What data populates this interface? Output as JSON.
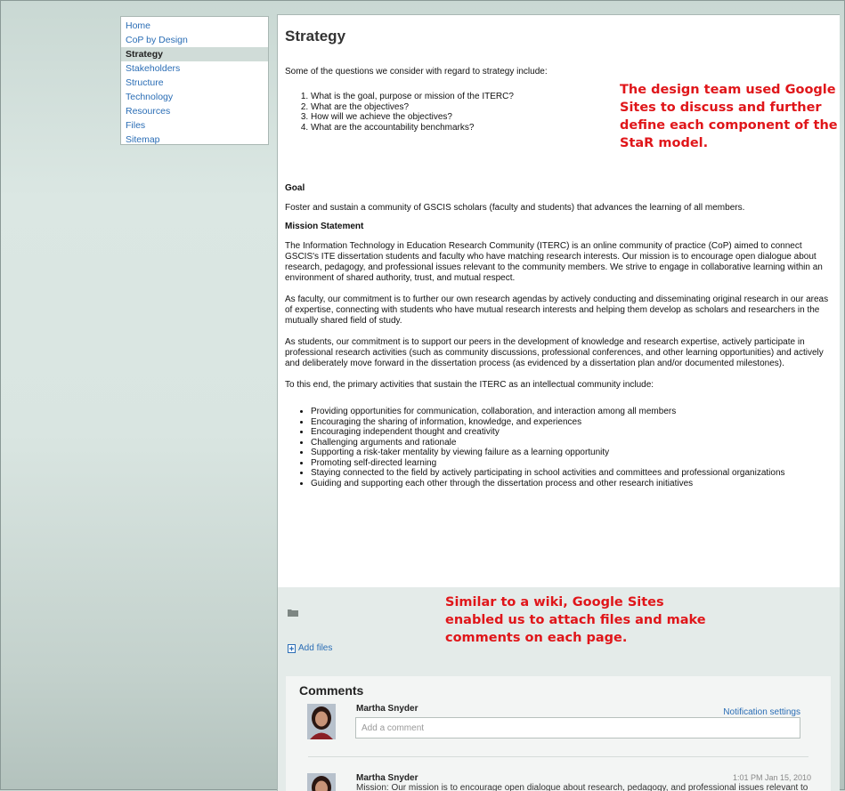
{
  "sidebar": {
    "items": [
      {
        "label": "Home",
        "active": false
      },
      {
        "label": "CoP by Design",
        "active": false
      },
      {
        "label": "Strategy",
        "active": true
      },
      {
        "label": "Stakeholders",
        "active": false
      },
      {
        "label": "Structure",
        "active": false
      },
      {
        "label": "Technology",
        "active": false
      },
      {
        "label": "Resources",
        "active": false
      },
      {
        "label": "Files",
        "active": false
      },
      {
        "label": "Sitemap",
        "active": false
      }
    ]
  },
  "page": {
    "title": "Strategy",
    "intro": "Some of the questions we consider with regard to strategy include:",
    "questions": [
      "What is the goal, purpose or mission of the ITERC?",
      "What are the objectives?",
      "How will we achieve the objectives?",
      "What are the accountability benchmarks?"
    ],
    "goal_heading": "Goal",
    "goal_text": "Foster and sustain a community of GSCIS scholars (faculty and students) that advances the learning of all members.",
    "mission_heading": "Mission Statement",
    "mission_text": "The Information Technology in Education Research Community (ITERC) is an online community of practice (CoP) aimed to connect GSCIS's ITE dissertation students and faculty who have matching research interests. Our mission is to encourage open dialogue about research, pedagogy, and professional issues relevant to the community members. We strive to engage in collaborative learning within an environment of shared authority, trust, and mutual respect.",
    "faculty_text": "As faculty, our commitment is to further our own research agendas by actively conducting and disseminating original research in our areas of expertise, connecting with students who have mutual research interests and helping them develop as scholars and researchers in the mutually shared field of study.",
    "students_text": "As students, our commitment is to support our peers in the development of knowledge and research expertise, actively participate in professional research activities (such as community discussions, professional conferences, and other learning opportunities) and actively and deliberately move forward in the dissertation process (as evidenced by a dissertation plan and/or documented milestones).",
    "activities_intro": "To this end, the primary activities that sustain the ITERC as an intellectual community include:",
    "activities": [
      "Providing opportunities for communication, collaboration, and interaction among all members",
      "Encouraging the sharing of information, knowledge, and experiences",
      "Encouraging independent thought and creativity",
      "Challenging arguments and rationale",
      "Supporting a risk-taker mentality by viewing failure as a learning opportunity",
      "Promoting self-directed learning",
      "Staying connected to the field by actively participating in school activities and committees and professional organizations",
      "Guiding and supporting each other through the dissertation process and other research initiatives"
    ]
  },
  "annotations": {
    "top": "The design team used Google Sites to discuss and further define each component of the StaR model.",
    "bottom": "Similar to a wiki, Google Sites enabled us to attach files and make comments on each page."
  },
  "attachments": {
    "add_files_label": "Add files"
  },
  "comments": {
    "title": "Comments",
    "notification_label": "Notification settings",
    "new_comment": {
      "author": "Martha Snyder",
      "placeholder": "Add a comment"
    },
    "items": [
      {
        "author": "Martha Snyder",
        "timestamp": "1:01 PM Jan 15, 2010",
        "text": "Mission: Our mission is to encourage open dialogue about research, pedagogy, and professional issues relevant to the community members. As faculty, our commitment is to help students develop as"
      }
    ]
  },
  "colors": {
    "link": "#2a6db5",
    "annotation": "#e0161a",
    "active_nav_bg": "#d0dcd8"
  }
}
